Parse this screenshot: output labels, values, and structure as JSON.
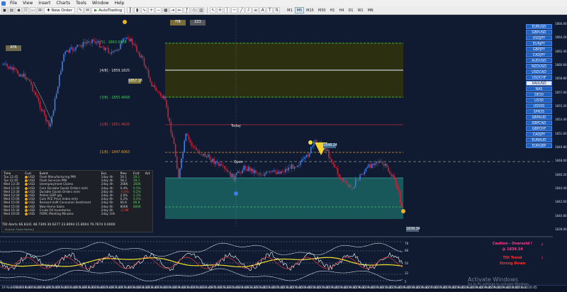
{
  "menu": [
    "File",
    "View",
    "Insert",
    "Charts",
    "Tools",
    "Window",
    "Help"
  ],
  "toolbar": {
    "new_order": "New Order",
    "autotrading": "AutoTrading",
    "timeframes": [
      "M1",
      "M5",
      "M15",
      "M30",
      "H1",
      "H4",
      "D1",
      "W1",
      "MN"
    ],
    "active_timeframe": "M5"
  },
  "chart": {
    "top_buttons": [
      "FIB",
      "ZZ3"
    ],
    "fib_levels": [
      {
        "label": "[5] - 1863.5858",
        "color": "#37d25a"
      },
      {
        "label": "[4/8] - 1859.1825",
        "color": "#e6e6e6"
      },
      {
        "label": "[3/8] - 1855.4668",
        "color": "#37d25a"
      },
      {
        "label": "[2/8] - 1851.4625",
        "color": "#d24a4a"
      },
      {
        "label": "[1/8] - 1847.6063",
        "color": "#e8a030"
      }
    ],
    "left_tag": "ATR",
    "today_label": "Today",
    "open_label": "Open",
    "price_tag_top": "1857.18",
    "price_tag_mid": "1848.24",
    "price_tag_end": "1839.34",
    "price_scale": [
      "1866.00",
      "1864.20",
      "1862.40",
      "1860.60",
      "1858.80",
      "1857.00",
      "1855.20",
      "1853.40",
      "1851.60",
      "1849.80",
      "1848.00",
      "1846.20",
      "1844.40",
      "1842.60",
      "1840.80",
      "1839.00"
    ],
    "symbols": [
      "EURUSD",
      "GBPUSD",
      "USDJPY",
      "EURJPY",
      "GBPJPY",
      "CADJPY",
      "AUDUSD",
      "NZDUSD",
      "USDCAD",
      "USDCHF",
      "XAUUSD",
      "NAS",
      "DE30",
      "US30",
      "US500",
      "SPN35",
      "GBPAUD",
      "GBPCAD",
      "GBPCHF",
      "CADJPY",
      "EURAUD",
      "EURGBP"
    ],
    "selected_symbol": "XAUUSD",
    "sub_title": "TDI Alerts  66.8341 48.7309 30.6277 23.8094 21.8004 79.7674 0.0000",
    "sub_scale": [
      "78",
      "68",
      "50",
      "32",
      "5"
    ],
    "caution_title": "Caution - Oversold !",
    "caution_price": "@ 1839.34",
    "trend_title": "TDI Trend",
    "trend_value": "Strong Down",
    "time_labels": [
      "19 Nov 2021",
      "19 Nov 14:05",
      "19 Nov 14:25",
      "19 Nov 14:45",
      "19 Nov 15:05",
      "19 Nov 15:25",
      "19 Nov 15:45",
      "19 Nov 16:05",
      "19 Nov 16:25",
      "19 Nov 16:45",
      "19 Nov 17:05",
      "19 Nov 17:25",
      "19 Nov 17:45",
      "19 Nov 18:05",
      "19 Nov 18:25",
      "19 Nov 18:45",
      "19 Nov 19:05",
      "19 Nov 19:25",
      "19 Nov 19:45",
      "19 Nov 20:05",
      "19 Nov 20:25",
      "19 Nov 20:45",
      "19 Nov 21:05",
      "19 Nov 21:25",
      "19 Nov 21:45",
      "19 Nov 22:05",
      "19 Nov 22:25",
      "19 Nov 23:05",
      "19 Nov 23:25",
      "22 Nov 01:05",
      "22 Nov 01:25",
      "22 Nov 01:45",
      "22 Nov 02:05",
      "22 Nov 02:25",
      "22 Nov 03:05",
      "22 Nov 03:25",
      "22 Nov 03:45",
      "22 Nov 04:05",
      "22 Nov 04:25",
      "22 Nov 04:45",
      "22 Nov 05:05",
      "22 Nov 05:25",
      "22 Nov 05:45",
      "22 Nov 06:05",
      "22 Nov 06:25",
      "22 Nov 06:45",
      "22 Nov 07:05",
      "22 Nov 07:25",
      "22 Nov 07:45",
      "22 Nov 08:05",
      "22 Nov 08:25",
      "22 Nov 08:45",
      "22 Nov 09:05",
      "22 Nov 09:25",
      "22 Nov 09:45",
      "22 Nov 10:05",
      "22 Nov 10:25",
      "22 Nov 10:45",
      "22 Nov 11:05",
      "22 Nov 11:25",
      "22 Nov 11:45",
      "22 Nov 12:05",
      "22 Nov 12:25"
    ]
  },
  "news": {
    "headers": [
      "Time",
      "Curr.",
      "Event",
      "Exc.",
      "Prev",
      "Fcst",
      "Act"
    ],
    "rows": [
      [
        "Tue 12:45",
        "USD",
        "Flash Manufacturing PMI",
        "1day 4h",
        "59.1",
        "59.1",
        ""
      ],
      [
        "Tue 12:45",
        "USD",
        "Flash Services PMI",
        "1day 4h",
        "58.2",
        "59.1",
        ""
      ],
      [
        "Wed 13:30",
        "USD",
        "Unemployment Claims",
        "2day 4h",
        "268K",
        "260K",
        ""
      ],
      [
        "Wed 13:30",
        "USD",
        "Core Durable Goods Orders m/m",
        "2day 4h",
        "0.4%",
        "0.5%",
        ""
      ],
      [
        "Wed 13:30",
        "USD",
        "Durable Goods Orders m/m",
        "2day 4h",
        "-0.4%",
        "0.2%",
        ""
      ],
      [
        "Wed 13:30",
        "USD",
        "Prelim GDP q/q",
        "2day 4h",
        "2.0%",
        "2.2%",
        ""
      ],
      [
        "Wed 15:00",
        "USD",
        "Core PCE Price Index m/m",
        "2day 6h",
        "0.2%",
        "0.4%",
        ""
      ],
      [
        "Wed 15:00",
        "USD",
        "Revised UoM Consumer Sentiment",
        "2day 6h",
        "66.8",
        "66.8",
        ""
      ],
      [
        "Wed 15:00",
        "USD",
        "New Home Sales",
        "2day 6h",
        "800K",
        "800K",
        ""
      ],
      [
        "Wed 15:30",
        "USD",
        "Crude Oil Inventories",
        "2day 6h",
        "-2.1M",
        "",
        ""
      ],
      [
        "Wed 19:00",
        "USD",
        "FOMC Meeting Minutes",
        "2day 10h",
        "",
        "",
        ""
      ]
    ],
    "source": "Source: Forex Factory"
  },
  "watermark": {
    "title": "Activate Windows",
    "subtitle": "Go to PC settings to activate Windows."
  },
  "colors": {
    "bg": "#101a30",
    "bull": "#3f7ce0",
    "bear": "#c0283a",
    "fib_box": "#2c3010",
    "demand_box": "#1b6e6a",
    "tdi_yellow": "#f2e22e"
  }
}
